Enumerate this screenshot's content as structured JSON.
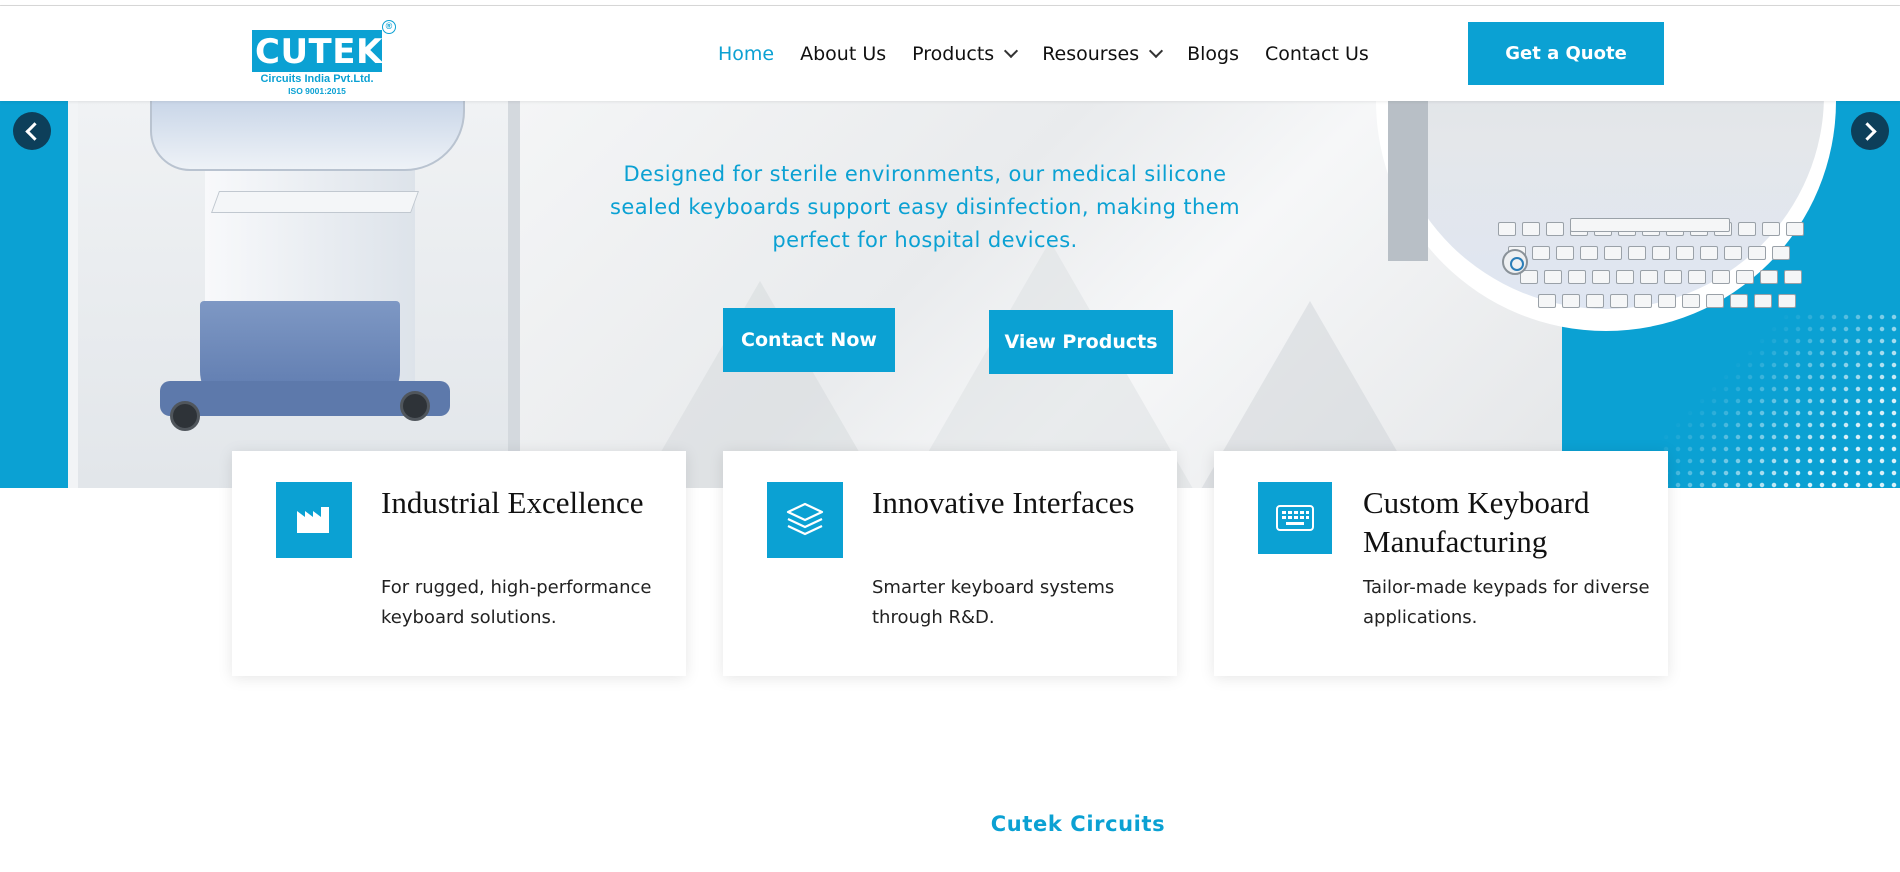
{
  "brand": {
    "logo_word": "CUTEK",
    "registered_mark": "®",
    "logo_subtitle": "Circuits India Pvt.Ltd.",
    "logo_iso": "ISO 9001:2015",
    "accent_color": "#0ba1d3",
    "arrow_color": "#0d3f5a"
  },
  "nav": {
    "items": [
      {
        "label": "Home",
        "active": true
      },
      {
        "label": "About Us"
      },
      {
        "label": "Products",
        "dropdown": true
      },
      {
        "label": "Resourses",
        "dropdown": true
      },
      {
        "label": "Blogs"
      },
      {
        "label": "Contact Us"
      }
    ],
    "cta_label": "Get a Quote"
  },
  "hero": {
    "text": "Designed for sterile environments, our medical silicone sealed keyboards support easy disinfection, making them perfect for hospital devices.",
    "contact_label": "Contact Now",
    "products_label": "View Products",
    "prev_icon": "chevron-left-icon",
    "next_icon": "chevron-right-icon"
  },
  "features": [
    {
      "icon": "factory-icon",
      "title": "Industrial Excellence",
      "description": "For rugged, high-performance keyboard solutions."
    },
    {
      "icon": "layers-icon",
      "title": "Innovative Interfaces",
      "description": "Smarter keyboard systems through R&D."
    },
    {
      "icon": "keyboard-icon",
      "title": "Custom Keyboard Manufacturing",
      "description": "Tailor-made keypads for diverse applications."
    }
  ],
  "section": {
    "label": "Cutek Circuits"
  }
}
